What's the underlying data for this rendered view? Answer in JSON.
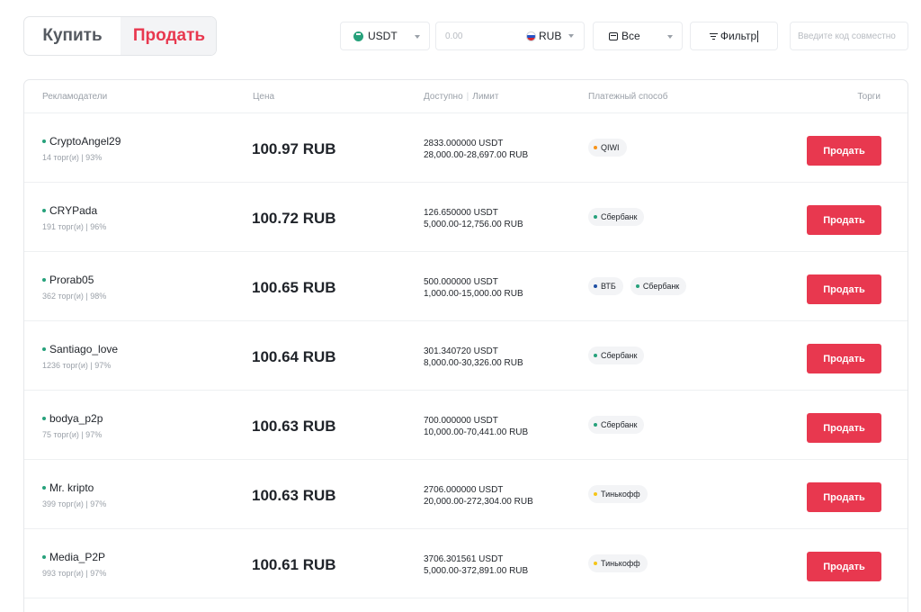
{
  "tabs": {
    "buy": "Купить",
    "sell": "Продать"
  },
  "filters": {
    "coin": "USDT",
    "amount_placeholder": "0.00",
    "fiat": "RUB",
    "payment": "Все",
    "filter_label": "Фильтр",
    "code_placeholder": "Введите код совместно"
  },
  "colors": {
    "accent": "#e8384f",
    "online": "#26a17b"
  },
  "table": {
    "headers": {
      "advertiser": "Рекламодатели",
      "price": "Цена",
      "available": "Доступно",
      "limit": "Лимит",
      "payment": "Платежный способ",
      "trade": "Торги"
    },
    "sell_label": "Продать",
    "rows": [
      {
        "name": "CryptoAngel29",
        "stats": "14 торг(и) | 93%",
        "price": "100.97 RUB",
        "available": "2833.000000 USDT",
        "limit": "28,000.00-28,697.00 RUB",
        "methods": [
          {
            "label": "QIWI",
            "color": "#f7931a"
          }
        ]
      },
      {
        "name": "CRYPada",
        "stats": "191 торг(и) | 96%",
        "price": "100.72 RUB",
        "available": "126.650000 USDT",
        "limit": "5,000.00-12,756.00 RUB",
        "methods": [
          {
            "label": "Сбербанк",
            "color": "#26a17b"
          }
        ]
      },
      {
        "name": "Prorab05",
        "stats": "362 торг(и) | 98%",
        "price": "100.65 RUB",
        "available": "500.000000 USDT",
        "limit": "1,000.00-15,000.00 RUB",
        "methods": [
          {
            "label": "ВТБ",
            "color": "#1e4fa3"
          },
          {
            "label": "Сбербанк",
            "color": "#26a17b"
          }
        ]
      },
      {
        "name": "Santiago_love",
        "stats": "1236 торг(и) | 97%",
        "price": "100.64 RUB",
        "available": "301.340720 USDT",
        "limit": "8,000.00-30,326.00 RUB",
        "methods": [
          {
            "label": "Сбербанк",
            "color": "#26a17b"
          }
        ]
      },
      {
        "name": "bodya_p2p",
        "stats": "75 торг(и) | 97%",
        "price": "100.63 RUB",
        "available": "700.000000 USDT",
        "limit": "10,000.00-70,441.00 RUB",
        "methods": [
          {
            "label": "Сбербанк",
            "color": "#26a17b"
          }
        ]
      },
      {
        "name": "Mr. kripto",
        "stats": "399 торг(и) | 97%",
        "price": "100.63 RUB",
        "available": "2706.000000 USDT",
        "limit": "20,000.00-272,304.00 RUB",
        "methods": [
          {
            "label": "Тинькофф",
            "color": "#f5c518"
          }
        ]
      },
      {
        "name": "Media_P2P",
        "stats": "993 торг(и) | 97%",
        "price": "100.61 RUB",
        "available": "3706.301561 USDT",
        "limit": "5,000.00-372,891.00 RUB",
        "methods": [
          {
            "label": "Тинькофф",
            "color": "#f5c518"
          }
        ]
      }
    ]
  }
}
